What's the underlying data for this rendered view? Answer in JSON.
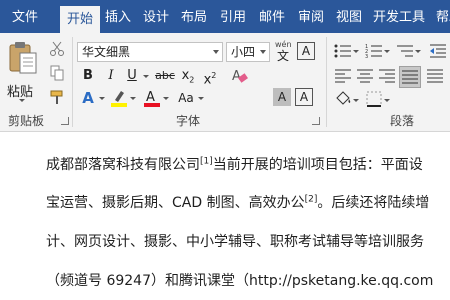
{
  "tabs": [
    "文件",
    "开始",
    "插入",
    "设计",
    "布局",
    "引用",
    "邮件",
    "审阅",
    "视图",
    "开发工具",
    "帮助"
  ],
  "ribbon": {
    "clipboard": {
      "paste_label": "粘贴",
      "group_label": "剪贴板"
    },
    "font": {
      "font_name": "华文细黑",
      "font_size": "小四",
      "wen_glyph": "wén",
      "group_label": "字体",
      "font_color": "#e81123",
      "highlight_color": "#fff200"
    },
    "paragraph": {
      "group_label": "段落"
    }
  },
  "document": {
    "line1": {
      "pre": "成都部落窝科技有限公司",
      "sup": "[1]",
      "post": "当前开展的培训项目包括：平面设"
    },
    "line2": {
      "pre": "宝运营、摄影后期、CAD 制图、高效办公",
      "sup": "[2]",
      "post": "。后续还将陆续增"
    },
    "line3": "计、网页设计、摄影、中小学辅导、职称考试辅导等培训服务",
    "line4": "（频道号 69247）和腾讯课堂（http://psketang.ke.qq.com"
  }
}
